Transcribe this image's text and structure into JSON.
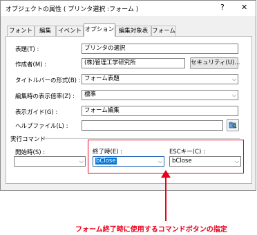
{
  "window": {
    "title": "オブジェクトの属性 ( プリンタ選択 :フォーム )",
    "help_label": "?",
    "close_label": "✕"
  },
  "tabs": [
    {
      "label": "フォント"
    },
    {
      "label": "編集"
    },
    {
      "label": "イベント"
    },
    {
      "label": "オプション"
    },
    {
      "label": "編集対象表"
    },
    {
      "label": "フォーム"
    }
  ],
  "form": {
    "title_label": "表題(T) :",
    "title_value": "プリンタの選択",
    "author_label": "作成者(M) :",
    "author_value": "(株)管理工学研究所",
    "security_button": "セキュリティ(U)...",
    "titlebar_style_label": "タイトルバーの形式(B) :",
    "titlebar_style_value": "フォーム表題",
    "zoom_label": "編集時の表示倍率(Z) :",
    "zoom_value": "標準",
    "guide_label": "表示ガイド(G) :",
    "guide_value": "フォーム編集",
    "help_file_label": "ヘルプファイル(L) :",
    "help_file_value": "",
    "exec_group_label": "実行コマンド",
    "start_label": "開始時(S) :",
    "start_value": "",
    "end_label": "終了時(E) :",
    "end_value": "bClose",
    "esc_label": "ESCキー(C) :",
    "esc_value": "bClose"
  },
  "annotation": {
    "text": "フォーム終了時に使用するコマンドボタンの指定",
    "color": "#e8001c"
  }
}
